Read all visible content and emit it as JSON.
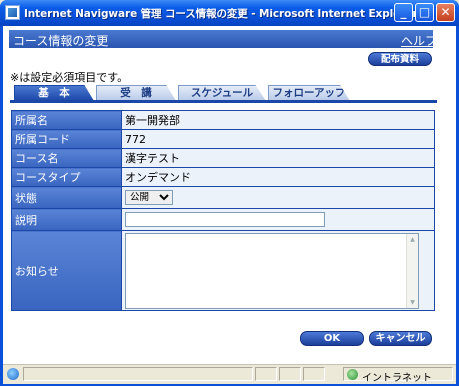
{
  "window": {
    "title": "Internet Navigware 管理 コース情報の変更 - Microsoft Internet Explorer",
    "minimize": "_",
    "maximize": "□",
    "close": "✕"
  },
  "header": {
    "title": "コース情報の変更",
    "help": "ヘルプ",
    "distribute_button": "配布資料"
  },
  "note": "※は設定必須項目です。",
  "tabs": [
    {
      "label": "基　本",
      "active": true
    },
    {
      "label": "受　講",
      "active": false
    },
    {
      "label": "スケジュール",
      "active": false
    },
    {
      "label": "フォローアップ",
      "active": false
    }
  ],
  "form": {
    "rows": [
      {
        "label": "所属名",
        "value": "第一開発部"
      },
      {
        "label": "所属コード",
        "value": "772"
      },
      {
        "label": "コース名",
        "value": "漢字テスト"
      },
      {
        "label": "コースタイプ",
        "value": "オンデマンド"
      }
    ],
    "status_label": "状態",
    "status_value": "公開",
    "description_label": "説明",
    "description_value": "",
    "notice_label": "お知らせ",
    "notice_value": ""
  },
  "buttons": {
    "ok": "OK",
    "cancel": "キャンセル"
  },
  "statusbar": {
    "zone": "イントラネット"
  }
}
